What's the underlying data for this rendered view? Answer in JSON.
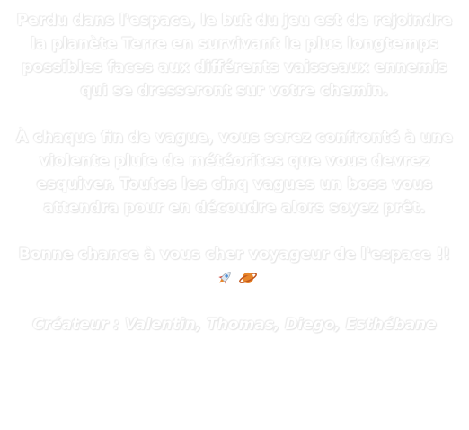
{
  "intro": {
    "paragraph_1": "Perdu dans l'espace, le but du jeu est de rejoindre la planète Terre en survivant le plus longtemps possibles faces aux différents vaisseaux ennemis qui se dresseront sur votre chemin.",
    "paragraph_2": "À chaque fin de vague, vous serez confronté à une violente pluie de météorites que vous devrez esquiver. Toutes les cinq vagues un boss vous attendra pour en découdre alors soyez prêt.",
    "good_luck": "Bonne chance à vous cher voyageur de l'espace !!",
    "creators": "Créateur : Valentin, Thomas, Diego, Esthébane"
  },
  "icons": {
    "rocket": "rocket-icon",
    "planet": "ringed-planet-icon"
  },
  "colors": {
    "text": "#ffffff",
    "outline": "#e6e6e6",
    "planet": "#e8862a",
    "rocket_flame": "#e8452a"
  }
}
